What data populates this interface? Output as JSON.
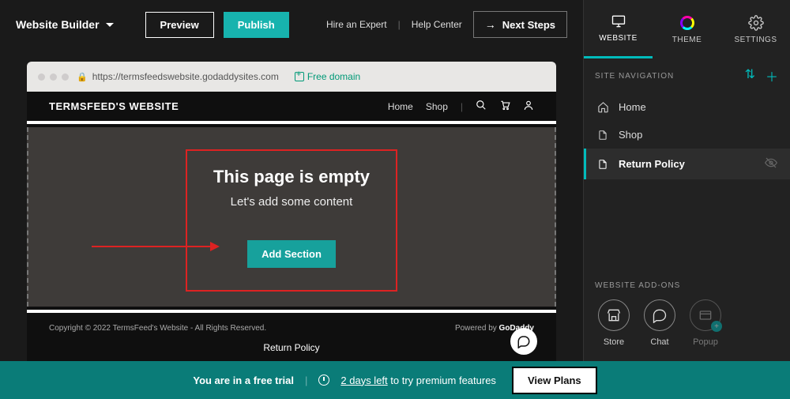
{
  "topbar": {
    "brand": "Website Builder",
    "preview": "Preview",
    "publish": "Publish",
    "hire": "Hire an Expert",
    "help": "Help Center",
    "next": "Next Steps"
  },
  "browser": {
    "url": "https://termsfeedswebsite.godaddysites.com",
    "free_domain": "Free domain"
  },
  "site": {
    "title": "TERMSFEED'S WEBSITE",
    "nav": {
      "home": "Home",
      "shop": "Shop"
    },
    "empty_title": "This page is empty",
    "empty_sub": "Let's add some content",
    "add_section": "Add Section",
    "footer_copyright": "Copyright © 2022 TermsFeed's Website - All Rights Reserved.",
    "footer_powered_by": "Powered by ",
    "footer_brand": "GoDaddy",
    "footer_link": "Return Policy"
  },
  "panel": {
    "tabs": {
      "website": "WEBSITE",
      "theme": "THEME",
      "settings": "SETTINGS"
    },
    "nav_label": "SITE NAVIGATION",
    "items": [
      {
        "label": "Home"
      },
      {
        "label": "Shop"
      },
      {
        "label": "Return Policy"
      }
    ],
    "addons_label": "WEBSITE ADD-ONS",
    "addons": {
      "store": "Store",
      "chat": "Chat",
      "popup": "Popup"
    }
  },
  "trial": {
    "prefix": "You are in a free trial",
    "days": "2 days left",
    "suffix": " to try premium features",
    "cta": "View Plans"
  }
}
